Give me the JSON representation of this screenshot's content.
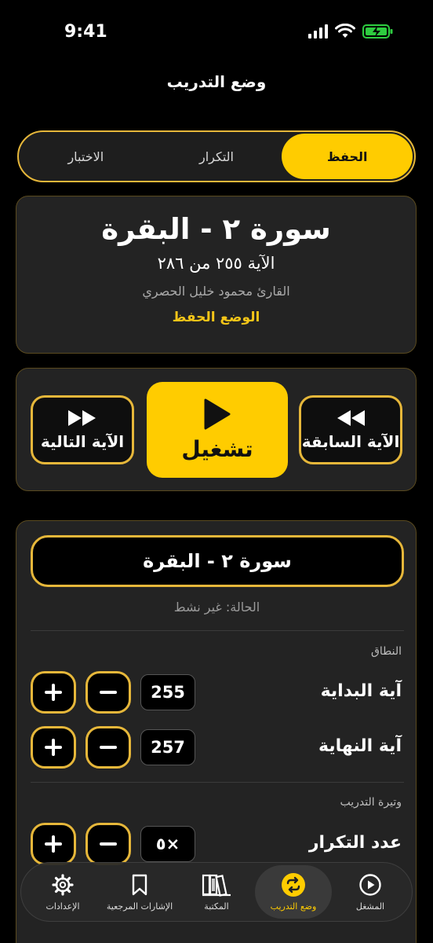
{
  "status": {
    "time": "9:41"
  },
  "nav": {
    "title": "وضع التدريب"
  },
  "segments": [
    {
      "label": "الحفظ",
      "active": true
    },
    {
      "label": "التكرار",
      "active": false
    },
    {
      "label": "الاختبار",
      "active": false
    }
  ],
  "info": {
    "surah_title": "سورة ٢ - البقرة",
    "ayah_line": "الآية ٢٥٥ من ٢٨٦",
    "reader_line": "القارئ محمود خليل الحصري",
    "mode_line": "الوضع الحفظ"
  },
  "controls": {
    "prev_label": "الآية السابقة",
    "play_label": "تشغيل",
    "next_label": "الآية التالية"
  },
  "settings": {
    "surah_pill": "سورة ٢ - البقرة",
    "status_line": "الحالة: غير نشط",
    "range_section": "النطاق",
    "start_label": "آية البداية",
    "start_value": "255",
    "end_label": "آية النهاية",
    "end_value": "257",
    "tempo_section": "وتيرة التدريب",
    "repeat_label": "عدد التكرار",
    "repeat_value": "٥×"
  },
  "tabs": [
    {
      "label": "المشغل",
      "icon": "play-circle-icon",
      "active": false
    },
    {
      "label": "وضع التدريب",
      "icon": "repeat-icon",
      "active": true
    },
    {
      "label": "المكتبة",
      "icon": "books-icon",
      "active": false
    },
    {
      "label": "الإشارات المرجعية",
      "icon": "bookmark-icon",
      "active": false
    },
    {
      "label": "الإعدادات",
      "icon": "gear-icon",
      "active": false
    }
  ],
  "colors": {
    "accent": "#ffcc00",
    "border": "#e6b73a",
    "card": "#232323",
    "background": "#000000"
  }
}
